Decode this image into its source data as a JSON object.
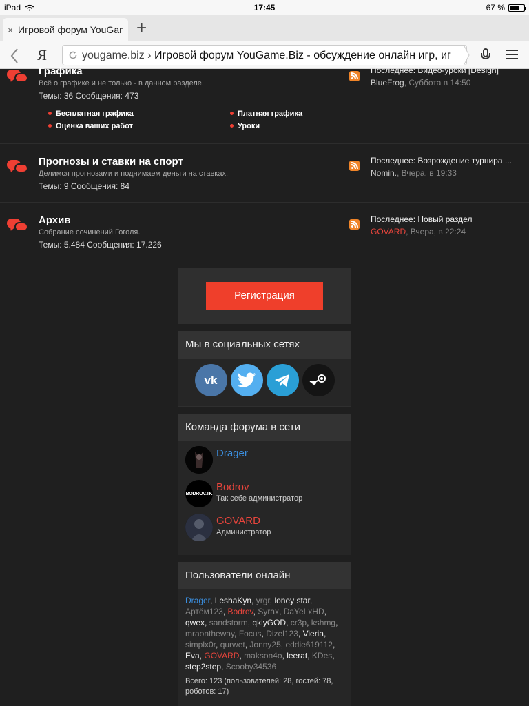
{
  "status": {
    "device": "iPad",
    "time": "17:45",
    "battery": "67 %",
    "battery_level": 0.67
  },
  "tab": {
    "title": "Игровой форум YouGame.Biz",
    "close": "×",
    "new_tab": "+"
  },
  "address": {
    "domain": "yougame.biz",
    "separator": "›",
    "page_title": "Игровой форум YouGame.Biz - обсуждение онлайн игр, иг",
    "browser_logo": "Я"
  },
  "forums": [
    {
      "title": "Графика",
      "description": "Всё о графике и не только - в данном разделе.",
      "stats": "Темы: 36 Сообщения: 473",
      "subforums": [
        "Бесплатная графика",
        "Платная графика",
        "Оценка ваших работ",
        "Уроки"
      ],
      "last_title": "Последнее: Видео-уроки [Design]",
      "last_author": "BlueFrog",
      "last_time": ", Суббота в 14:50",
      "author_red": false
    },
    {
      "title": "Прогнозы и ставки на спорт",
      "description": "Делимся прогнозами и поднимаем деньги на ставках.",
      "stats": "Темы: 9 Сообщения: 84",
      "last_title": "Последнее: Возрождение турнира ...",
      "last_author": "Nomin.",
      "last_time": ", Вчера, в 19:33",
      "author_red": false
    },
    {
      "title": "Архив",
      "description": "Собрание сочинений Гоголя.",
      "stats": "Темы: 5.484 Сообщения: 17.226",
      "last_title": "Последнее: Новый раздел",
      "last_author": "GOVARD",
      "last_time": ", Вчера, в 22:24",
      "author_red": true
    }
  ],
  "register": {
    "label": "Регистрация"
  },
  "social": {
    "title": "Мы в социальных сетях",
    "vk_text": "vk",
    "icons": [
      "vk-icon",
      "twitter-icon",
      "telegram-icon",
      "steam-icon"
    ]
  },
  "team": {
    "title": "Команда форума в сети",
    "members": [
      {
        "name": "Drager",
        "role": "",
        "color": "#3b8ede"
      },
      {
        "name": "Bodrov",
        "role": "Так себе администратор",
        "color": "#e8453c",
        "avatar_text": "BODROV.TK"
      },
      {
        "name": "GOVARD",
        "role": "Администратор",
        "color": "#e8453c"
      }
    ]
  },
  "online": {
    "title": "Пользователи онлайн",
    "users": [
      {
        "n": "Drager",
        "c": "blue"
      },
      {
        "n": "LeshaKyn",
        "c": ""
      },
      {
        "n": "yrgr",
        "c": "grey"
      },
      {
        "n": "loney star",
        "c": ""
      },
      {
        "n": "Артём123",
        "c": "grey"
      },
      {
        "n": "Bodrov",
        "c": "red"
      },
      {
        "n": "Syrax",
        "c": "grey"
      },
      {
        "n": "DaYeLxHD",
        "c": "grey"
      },
      {
        "n": "qwex",
        "c": ""
      },
      {
        "n": "sandstorm",
        "c": "grey"
      },
      {
        "n": "qklyGOD",
        "c": ""
      },
      {
        "n": "cr3p",
        "c": "grey"
      },
      {
        "n": "kshmg",
        "c": "grey"
      },
      {
        "n": "mraontheway",
        "c": "grey"
      },
      {
        "n": "Focus",
        "c": "grey"
      },
      {
        "n": "Dizel123",
        "c": "grey"
      },
      {
        "n": "Vieria",
        "c": ""
      },
      {
        "n": "simplx0r",
        "c": "grey"
      },
      {
        "n": "qurwet",
        "c": "grey"
      },
      {
        "n": "Jonny25",
        "c": "grey"
      },
      {
        "n": "eddie619112",
        "c": "grey"
      },
      {
        "n": "Eva",
        "c": ""
      },
      {
        "n": "GOVARD",
        "c": "red"
      },
      {
        "n": "makson4o",
        "c": "grey"
      },
      {
        "n": "leerat",
        "c": ""
      },
      {
        "n": "KDes",
        "c": "grey"
      },
      {
        "n": "step2step",
        "c": ""
      },
      {
        "n": "Scooby34536",
        "c": "grey"
      }
    ],
    "total": "Всего: 123 (пользователей: 28, гостей: 78, роботов: 17)"
  }
}
